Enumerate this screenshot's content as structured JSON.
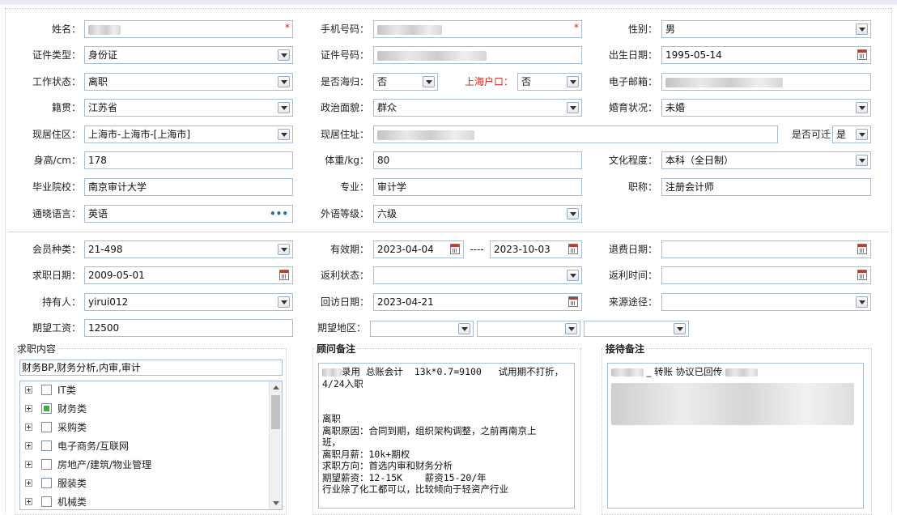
{
  "form": {
    "name_label": "姓名：",
    "phone_label": "手机号码：",
    "gender_label": "性别：",
    "gender_value": "男",
    "id_type_label": "证件类型：",
    "id_type_value": "身份证",
    "id_number_label": "证件号码：",
    "birth_label": "出生日期：",
    "birth_value": "1995-05-14",
    "work_status_label": "工作状态：",
    "work_status_value": "离职",
    "returnee_label": "是否海归：",
    "returnee_value": "否",
    "hukou_label": "上海户口：",
    "hukou_value": "否",
    "email_label": "电子邮箱：",
    "native_label": "籍贯：",
    "native_value": "江苏省",
    "political_label": "政治面貌：",
    "political_value": "群众",
    "marital_label": "婚育状况：",
    "marital_value": "未婚",
    "region_label": "现居住区：",
    "region_value": "上海市-上海市-[上海市]",
    "address_label": "现居住址：",
    "relocate_label": "是否可迁",
    "relocate_value": "是",
    "height_label": "身高/cm：",
    "height_value": "178",
    "weight_label": "体重/kg：",
    "weight_value": "80",
    "education_label": "文化程度：",
    "education_value": "本科（全日制）",
    "school_label": "毕业院校：",
    "school_value": "南京审计大学",
    "major_label": "专业：",
    "major_value": "审计学",
    "title_label": "职称：",
    "title_value": "注册会计师",
    "language_label": "通晓语言：",
    "language_value": "英语",
    "language_more": "•••",
    "lang_level_label": "外语等级：",
    "lang_level_value": "六级",
    "required_mark": "*"
  },
  "membership": {
    "member_type_label": "会员种类：",
    "member_type_value": "21-498",
    "validity_label": "有效期：",
    "validity_start": "2023-04-04",
    "validity_sep": "----",
    "validity_end": "2023-10-03",
    "refund_date_label": "退费日期：",
    "job_date_label": "求职日期：",
    "job_date_value": "2009-05-01",
    "rebate_status_label": "返利状态：",
    "rebate_time_label": "返利时间：",
    "holder_label": "持有人：",
    "holder_value": "yirui012",
    "visit_date_label": "回访日期：",
    "visit_date_value": "2023-04-21",
    "source_label": "来源途径：",
    "salary_label": "期望工资：",
    "salary_value": "12500",
    "area_label": "期望地区："
  },
  "job_content": {
    "title": "求职内容",
    "summary": "财务BP,财务分析,内审,审计",
    "tree": [
      {
        "label": "IT类",
        "checked": false
      },
      {
        "label": "财务类",
        "checked": true
      },
      {
        "label": "采购类",
        "checked": false
      },
      {
        "label": "电子商务/互联网",
        "checked": false
      },
      {
        "label": "房地产/建筑/物业管理",
        "checked": false
      },
      {
        "label": "服装类",
        "checked": false
      },
      {
        "label": "机械类",
        "checked": false
      }
    ]
  },
  "advisor_notes": {
    "title": "顾问备注",
    "text": "录用 总账会计  13k*0.7=9100   试用期不打折，\n4/24入职\n\n\n离职\n离职原因：合同到期，组织架构调整，之前再南京上\n班，\n离职月薪：10k+期权\n求职方向：首选内审和财务分析\n期望薪资：12-15K    薪资15-20/年\n行业除了化工都可以，比较倾向于轻资产行业"
  },
  "reception_notes": {
    "title": "接待备注",
    "text": "_ 转账 协议已回传"
  }
}
